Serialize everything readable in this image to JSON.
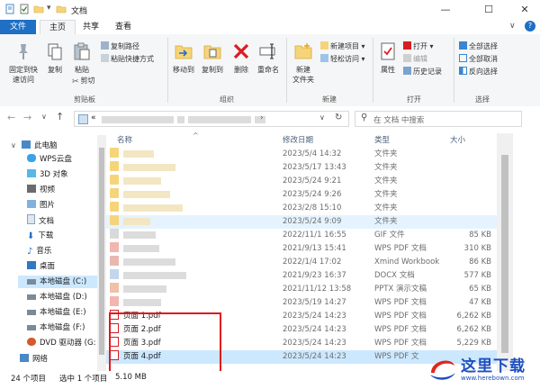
{
  "window": {
    "title": "文档"
  },
  "tabs": [
    {
      "label": "文件"
    },
    {
      "label": "主页"
    },
    {
      "label": "共享"
    },
    {
      "label": "查看"
    }
  ],
  "ribbon": {
    "clipboard": {
      "pin_label_1": "固定到快",
      "pin_label_2": "速访问",
      "copy": "复制",
      "paste": "粘贴",
      "copy_path": "复制路径",
      "paste_shortcut": "粘贴快捷方式",
      "cut": "剪切",
      "group": "剪贴板"
    },
    "organize": {
      "move_to": "移动到",
      "copy_to": "复制到",
      "delete": "删除",
      "rename": "重命名",
      "group": "组织"
    },
    "new": {
      "new_folder_1": "新建",
      "new_folder_2": "文件夹",
      "new_item": "新建项目",
      "easy_access": "轻松访问",
      "group": "新建"
    },
    "open": {
      "properties": "属性",
      "open": "打开",
      "edit": "编辑",
      "history": "历史记录",
      "group": "打开"
    },
    "select": {
      "select_all": "全部选择",
      "select_none": "全部取消",
      "invert": "反向选择",
      "group": "选择"
    }
  },
  "address": {
    "prefix": "«",
    "search_placeholder": "在 文档 中搜索"
  },
  "nav": [
    {
      "label": "此电脑",
      "icon": "computer-icon"
    },
    {
      "label": "WPS云盘",
      "icon": "cloud-icon"
    },
    {
      "label": "3D 对象",
      "icon": "cube-icon"
    },
    {
      "label": "视频",
      "icon": "video-icon"
    },
    {
      "label": "图片",
      "icon": "image-icon"
    },
    {
      "label": "文档",
      "icon": "document-icon"
    },
    {
      "label": "下载",
      "icon": "download-icon"
    },
    {
      "label": "音乐",
      "icon": "music-icon"
    },
    {
      "label": "桌面",
      "icon": "desktop-icon"
    },
    {
      "label": "本地磁盘 (C:)",
      "icon": "drive-icon"
    },
    {
      "label": "本地磁盘 (D:)",
      "icon": "drive-icon"
    },
    {
      "label": "本地磁盘 (E:)",
      "icon": "drive-icon"
    },
    {
      "label": "本地磁盘 (F:)",
      "icon": "drive-icon"
    },
    {
      "label": "DVD 驱动器 (G:",
      "icon": "dvd-icon"
    },
    {
      "label": "网络",
      "icon": "network-icon"
    }
  ],
  "columns": {
    "name": "名称",
    "date": "修改日期",
    "type": "类型",
    "size": "大小"
  },
  "rows": [
    {
      "name": "",
      "date": "2023/5/4 14:32",
      "type": "文件夹",
      "size": "",
      "kind": "folder"
    },
    {
      "name": "",
      "date": "2023/5/17 13:43",
      "type": "文件夹",
      "size": "",
      "kind": "folder"
    },
    {
      "name": "",
      "date": "2023/5/24 9:21",
      "type": "文件夹",
      "size": "",
      "kind": "folder"
    },
    {
      "name": "",
      "date": "2023/5/24 9:26",
      "type": "文件夹",
      "size": "",
      "kind": "folder"
    },
    {
      "name": "",
      "date": "2023/2/8 15:10",
      "type": "文件夹",
      "size": "",
      "kind": "folder"
    },
    {
      "name": "",
      "date": "2023/5/24 9:09",
      "type": "文件夹",
      "size": "",
      "kind": "folder"
    },
    {
      "name": "",
      "date": "2022/11/1 16:55",
      "type": "GIF 文件",
      "size": "85 KB",
      "kind": "blur"
    },
    {
      "name": "",
      "date": "2021/9/13 15:41",
      "type": "WPS PDF 文档",
      "size": "310 KB",
      "kind": "blur"
    },
    {
      "name": "",
      "date": "2022/1/4 17:02",
      "type": "Xmind Workbook",
      "size": "86 KB",
      "kind": "blur"
    },
    {
      "name": "",
      "date": "2021/9/23 16:37",
      "type": "DOCX 文档",
      "size": "577 KB",
      "kind": "blur"
    },
    {
      "name": "",
      "date": "2021/11/12 13:58",
      "type": "PPTX 演示文稿",
      "size": "65 KB",
      "kind": "blur"
    },
    {
      "name": "",
      "date": "2023/5/19 14:27",
      "type": "WPS PDF 文档",
      "size": "47 KB",
      "kind": "blur"
    },
    {
      "name": "页面 1.pdf",
      "date": "2023/5/24 14:23",
      "type": "WPS PDF 文档",
      "size": "6,262 KB",
      "kind": "pdf"
    },
    {
      "name": "页面 2.pdf",
      "date": "2023/5/24 14:23",
      "type": "WPS PDF 文档",
      "size": "6,262 KB",
      "kind": "pdf"
    },
    {
      "name": "页面 3.pdf",
      "date": "2023/5/24 14:23",
      "type": "WPS PDF 文档",
      "size": "5,229 KB",
      "kind": "pdf"
    },
    {
      "name": "页面 4.pdf",
      "date": "2023/5/24 14:23",
      "type": "WPS PDF 文",
      "size": "",
      "kind": "pdf"
    }
  ],
  "status": {
    "count": "24 个项目",
    "selected": "选中 1 个项目",
    "size": "5.10 MB"
  },
  "watermark": {
    "text": "这里下载",
    "url": "www.herebown.com"
  }
}
